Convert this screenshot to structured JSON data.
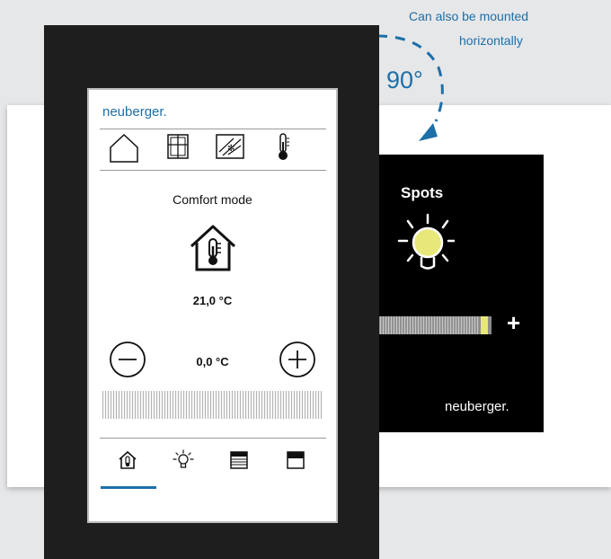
{
  "annotation": {
    "line1": "Can also be mounted",
    "line2": "horizontally",
    "degrees": "90°",
    "color": "#1d6fa8"
  },
  "portrait": {
    "brand": "neuberger.",
    "top_icons": [
      "house-icon",
      "window-icon",
      "frost-window-icon",
      "thermometer-icon"
    ],
    "mode_label": "Comfort mode",
    "current_temp": "21,0 °C",
    "setpoint_offset": "0,0 °C",
    "nav_icons": [
      "house-thermometer-icon",
      "lightbulb-icon",
      "blind-closed-icon",
      "blind-open-icon"
    ],
    "active_nav": 0,
    "accent": "#1d6fa8"
  },
  "landscape": {
    "title": "Spots",
    "brand": "neuberger.",
    "plus_label": "+",
    "bulb_color": "#e8e87a"
  }
}
